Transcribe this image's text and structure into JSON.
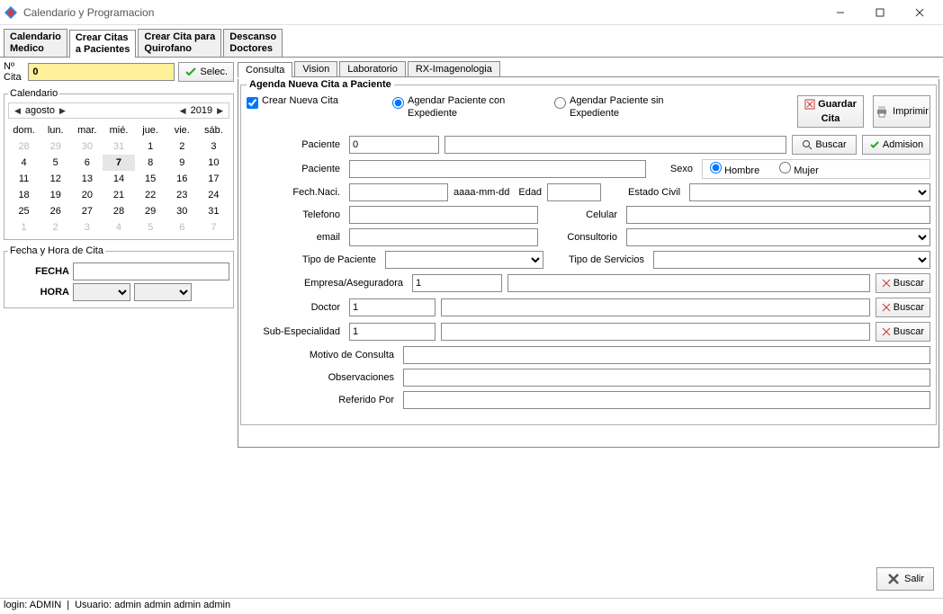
{
  "window": {
    "title": "Calendario y Programacion"
  },
  "menutabs": [
    {
      "l1": "Calendario",
      "l2": "Medico"
    },
    {
      "l1": "Crear Citas",
      "l2": "a Pacientes"
    },
    {
      "l1": "Crear Cita para",
      "l2": "Quirofano"
    },
    {
      "l1": "Descanso",
      "l2": "Doctores"
    }
  ],
  "ncita": {
    "label": "Nº Cita",
    "value": "0",
    "selec": "Selec."
  },
  "calendar": {
    "legend": "Calendario",
    "month": "agosto",
    "year": "2019",
    "weekdays": [
      "dom.",
      "lun.",
      "mar.",
      "mié.",
      "jue.",
      "vie.",
      "sáb."
    ],
    "grid": [
      [
        {
          "d": "28",
          "o": 1
        },
        {
          "d": "29",
          "o": 1
        },
        {
          "d": "30",
          "o": 1
        },
        {
          "d": "31",
          "o": 1
        },
        {
          "d": "1"
        },
        {
          "d": "2"
        },
        {
          "d": "3"
        }
      ],
      [
        {
          "d": "4"
        },
        {
          "d": "5"
        },
        {
          "d": "6"
        },
        {
          "d": "7",
          "t": 1
        },
        {
          "d": "8"
        },
        {
          "d": "9"
        },
        {
          "d": "10"
        }
      ],
      [
        {
          "d": "11"
        },
        {
          "d": "12"
        },
        {
          "d": "13"
        },
        {
          "d": "14"
        },
        {
          "d": "15"
        },
        {
          "d": "16"
        },
        {
          "d": "17"
        }
      ],
      [
        {
          "d": "18"
        },
        {
          "d": "19"
        },
        {
          "d": "20"
        },
        {
          "d": "21"
        },
        {
          "d": "22"
        },
        {
          "d": "23"
        },
        {
          "d": "24"
        }
      ],
      [
        {
          "d": "25"
        },
        {
          "d": "26"
        },
        {
          "d": "27"
        },
        {
          "d": "28"
        },
        {
          "d": "29"
        },
        {
          "d": "30"
        },
        {
          "d": "31"
        }
      ],
      [
        {
          "d": "1",
          "o": 1
        },
        {
          "d": "2",
          "o": 1
        },
        {
          "d": "3",
          "o": 1
        },
        {
          "d": "4",
          "o": 1
        },
        {
          "d": "5",
          "o": 1
        },
        {
          "d": "6",
          "o": 1
        },
        {
          "d": "7",
          "o": 1
        }
      ]
    ]
  },
  "fechahora": {
    "legend": "Fecha y Hora de Cita",
    "fecha_lbl": "FECHA",
    "hora_lbl": "HORA"
  },
  "subtabs": [
    "Consulta",
    "Vision",
    "Laboratorio",
    "RX-Imagenologia"
  ],
  "agenda": {
    "legend": "Agenda Nueva Cita a Paciente",
    "opt1": "Crear Nueva Cita",
    "opt2": "Agendar Paciente con Expediente",
    "opt3": "Agendar Paciente sin Expediente",
    "guardar": "Guardar",
    "cita": "Cita",
    "imprimir": "Imprimir",
    "paciente_lbl": "Paciente",
    "paciente_val": "0",
    "buscar": "Buscar",
    "admision": "Admision",
    "paciente2_lbl": "Paciente",
    "sexo_lbl": "Sexo",
    "hombre": "Hombre",
    "mujer": "Mujer",
    "fechnaci_lbl": "Fech.Naci.",
    "fechhint": "aaaa-mm-dd",
    "edad_lbl": "Edad",
    "estadocivil_lbl": "Estado Civil",
    "telefono_lbl": "Telefono",
    "celular_lbl": "Celular",
    "email_lbl": "email",
    "consultorio_lbl": "Consultorio",
    "tipopac_lbl": "Tipo de Paciente",
    "tiposerv_lbl": "Tipo de Servicios",
    "empresa_lbl": "Empresa/Aseguradora",
    "empresa_val": "1",
    "doctor_lbl": "Doctor",
    "doctor_val": "1",
    "subesp_lbl": "Sub-Especialidad",
    "subesp_val": "1",
    "motivo_lbl": "Motivo de Consulta",
    "observ_lbl": "Observaciones",
    "referido_lbl": "Referido Por"
  },
  "salir": "Salir",
  "status": {
    "login": "login: ADMIN",
    "usuario": "Usuario: admin admin admin admin"
  }
}
